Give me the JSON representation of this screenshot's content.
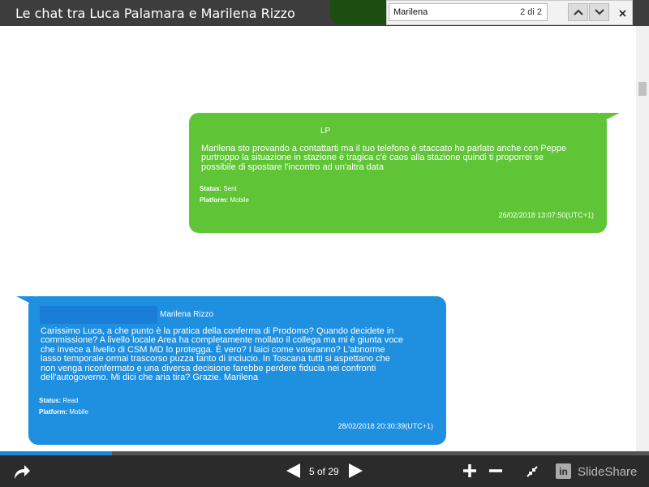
{
  "window": {
    "title": "Le chat tra Luca Palamara e Marilena Rizzo"
  },
  "find": {
    "query": "Marilena",
    "count": "2 di 2"
  },
  "colors": {
    "sent_bubble": "#5fc536",
    "received_bubble": "#1f8fe0",
    "toolbar": "#3d3d3d",
    "bottom_bar": "#2b2b2b",
    "progress": "#1b87d6"
  },
  "icons": {
    "find_prev": "chevron-up-icon",
    "find_next": "chevron-down-icon",
    "find_close": "close-icon",
    "share": "share-icon",
    "prev_page": "arrow-left-icon",
    "next_page": "arrow-right-icon",
    "zoom_in": "plus-icon",
    "zoom_out": "minus-icon",
    "collapse": "collapse-icon",
    "brand": "linkedin-icon"
  },
  "messages": [
    {
      "sender": "LP",
      "text": "Marilena sto provando a contattarti ma il tuo telefono è staccato ho parlato anche con Peppe\npurtroppo la situazione in stazione è tragica c'è caos alla stazione quindi ti proporrei se\npossibile di spostare l'incontro ad un'altra data",
      "status_label": "Status:",
      "status": "Sent",
      "platform_label": "Platform:",
      "platform": "Mobile",
      "timestamp": "26/02/2018 13:07:50(UTC+1)"
    },
    {
      "sender": "Marilena Rizzo",
      "text": "Carissimo Luca, a che punto è la pratica della conferma di Prodomo? Quando decidete in\ncommissione? A livello locale Area ha completamente mollato il collega ma mi è giunta voce\nche invece a livello di CSM MD lo protegga. È vero? I laici come voteranno? L'abnorme\nlasso temporale ormai trascorso puzza tanto di inciucio. In Toscana tutti si aspettano che\nnon venga riconfermato e una diversa decisione farebbe perdere fiducia nei confronti\ndell'autogoverno. Mi dici che aria tira? Grazie. Marilena",
      "status_label": "Status:",
      "status": "Read",
      "platform_label": "Platform:",
      "platform": "Mobile",
      "timestamp": "28/02/2018 20:30:39(UTC+1)"
    }
  ],
  "viewer": {
    "page_indicator": "5 of 29",
    "progress_fraction": 0.172,
    "brand": "SlideShare",
    "brand_logo_text": "in"
  }
}
